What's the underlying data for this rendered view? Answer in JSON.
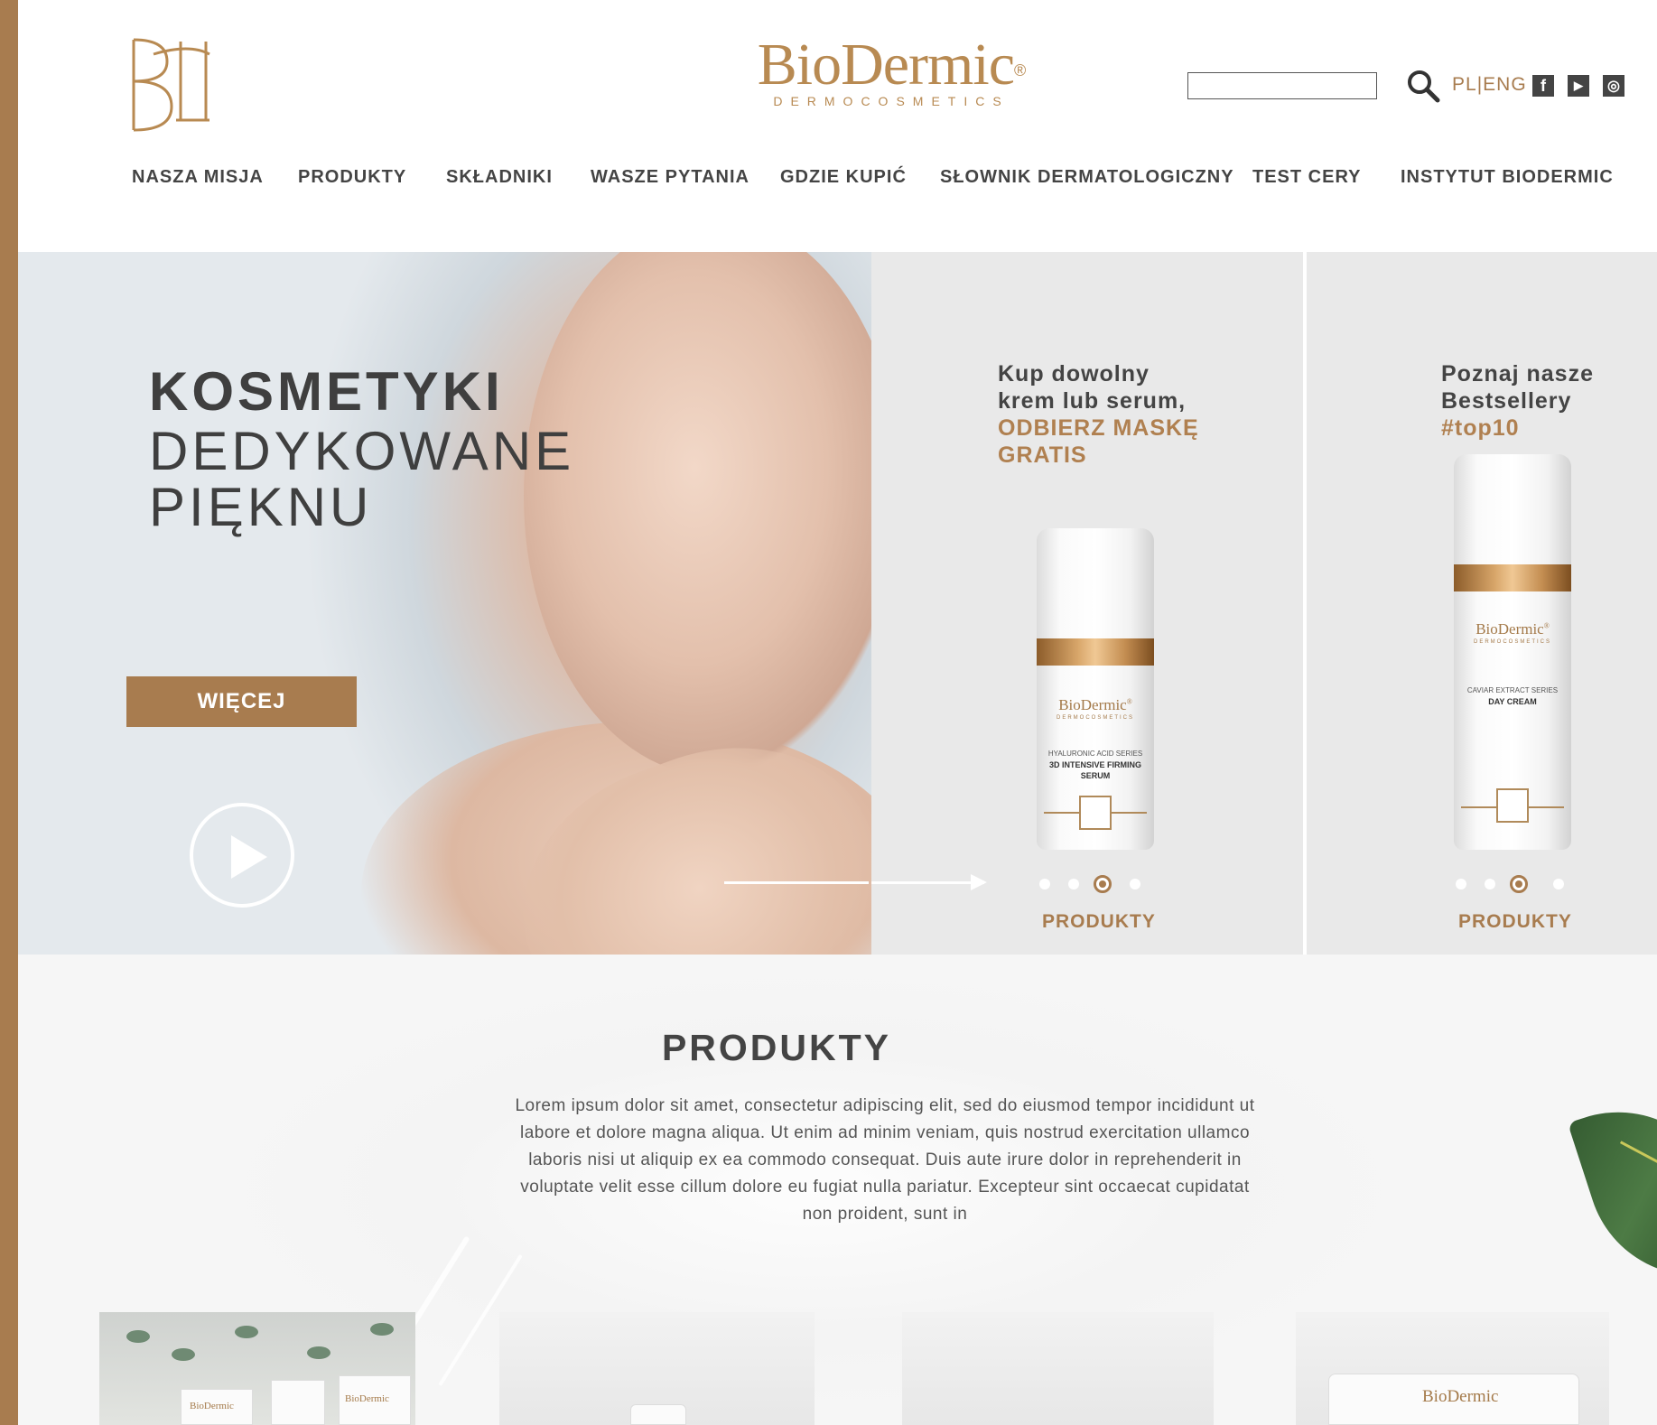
{
  "header": {
    "brand_name": "BioDermic",
    "brand_reg": "®",
    "brand_sub": "DERMOCOSMETICS",
    "lang_pl": "PL",
    "lang_sep": "|",
    "lang_en": "ENG",
    "social": {
      "facebook": "f",
      "youtube": "▶",
      "instagram": "◎"
    }
  },
  "nav": [
    "NASZA MISJA",
    "PRODUKTY",
    "SKŁADNIKI",
    "WASZE PYTANIA",
    "GDZIE KUPIĆ",
    "SŁOWNIK DERMATOLOGICZNY",
    "TEST CERY",
    "INSTYTUT BIODERMIC"
  ],
  "hero": {
    "title_bold": "KOSMETYKI",
    "title_line2": "DEDYKOWANE",
    "title_line3": "PIĘKNU",
    "button": "WIĘCEJ"
  },
  "promo1": {
    "line1": "Kup dowolny",
    "line2": "krem lub serum,",
    "accent1": "ODBIERZ MASKĘ",
    "accent2": "GRATIS",
    "bottle_brand": "BioDermic",
    "bottle_reg": "®",
    "bottle_sub": "DERMOCOSMETICS",
    "bottle_series": "HYALURONIC ACID SERIES",
    "bottle_name1": "3D INTENSIVE FIRMING",
    "bottle_name2": "SERUM",
    "link": "PRODUKTY",
    "active_dot": 2
  },
  "promo2": {
    "line1": "Poznaj nasze",
    "line2": "Bestsellery",
    "accent1": "#top10",
    "bottle_brand": "BioDermic",
    "bottle_reg": "®",
    "bottle_sub": "DERMOCOSMETICS",
    "bottle_series": "CAVIAR EXTRACT SERIES",
    "bottle_name1": "DAY CREAM",
    "link": "PRODUKTY",
    "active_dot": 2
  },
  "products": {
    "title": "PRODUKTY",
    "description": "Lorem ipsum dolor sit amet, consectetur adipiscing elit, sed do eiusmod tempor incididunt ut labore et dolore magna aliqua. Ut enim ad minim veniam, quis nostrud exercitation ullamco laboris nisi ut aliquip ex ea commodo consequat. Duis aute irure dolor in reprehenderit in voluptate velit esse cillum dolore eu fugiat nulla pariatur. Excepteur sint occaecat cupidatat non proident, sunt in",
    "card1_brand_a": "BioDermic",
    "card1_brand_b": "BioDermic",
    "card4_brand": "BioDermic"
  },
  "colors": {
    "accent": "#a87c4f",
    "text": "#444444",
    "panel": "#e9e9e9"
  }
}
